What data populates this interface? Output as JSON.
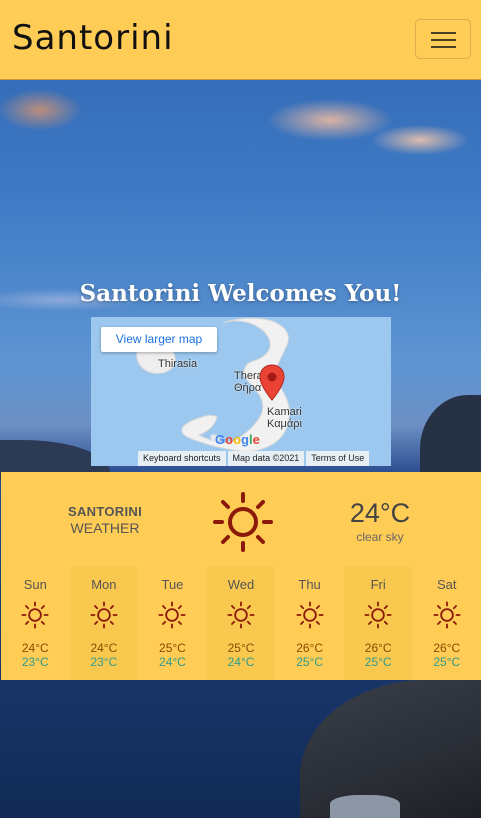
{
  "navbar": {
    "brand": "Santorini",
    "menu_icon": "hamburger-menu-icon"
  },
  "hero": {
    "welcome": "Santorini Welcomes You!"
  },
  "map": {
    "larger_map_label": "View larger map",
    "labels": {
      "thirasia": "Thirasia",
      "thera_en": "Thera",
      "thera_gr": "Θήρα",
      "kamari_en": "Kamari",
      "kamari_gr": "Καμάρι"
    },
    "google": "Google",
    "footer": {
      "shortcuts": "Keyboard shortcuts",
      "data": "Map data ©2021",
      "terms": "Terms of Use"
    },
    "pin_icon": "map-pin-icon"
  },
  "weather": {
    "city": "SANTORINI",
    "subtitle": "WEATHER",
    "icon": "sun-icon",
    "temp": "24°C",
    "description": "clear sky",
    "colors": {
      "background": "#ffcc55",
      "icon": "#8b1a0a",
      "high": "#8a4a00",
      "low": "#2f9a8e"
    },
    "forecast": [
      {
        "day": "Sun",
        "high": "24°C",
        "low": "23°C"
      },
      {
        "day": "Mon",
        "high": "24°C",
        "low": "23°C"
      },
      {
        "day": "Tue",
        "high": "25°C",
        "low": "24°C"
      },
      {
        "day": "Wed",
        "high": "25°C",
        "low": "24°C"
      },
      {
        "day": "Thu",
        "high": "26°C",
        "low": "25°C"
      },
      {
        "day": "Fri",
        "high": "26°C",
        "low": "25°C"
      },
      {
        "day": "Sat",
        "high": "26°C",
        "low": "25°C"
      }
    ]
  }
}
